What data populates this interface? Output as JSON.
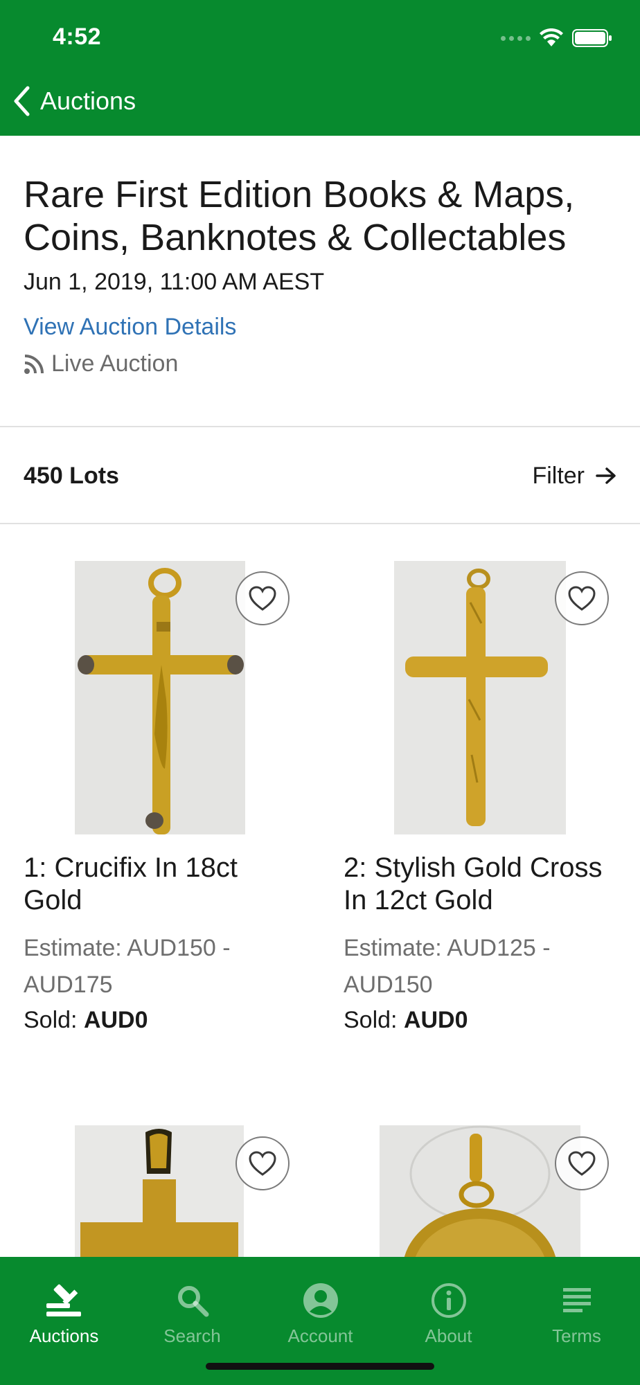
{
  "status_bar": {
    "time": "4:52"
  },
  "nav": {
    "back_label": "Auctions"
  },
  "auction": {
    "title": "Rare First Edition Books & Maps, Coins, Banknotes & Collectables",
    "date": "Jun 1, 2019, 11:00 AM AEST",
    "details_link": "View Auction Details",
    "type_label": "Live Auction"
  },
  "lots_header": {
    "count_label": "450 Lots",
    "filter_label": "Filter"
  },
  "lots": [
    {
      "title": "1: Crucifix In 18ct Gold",
      "estimate": "Estimate: AUD150 - AUD175",
      "sold_label": "Sold:",
      "sold_value": "AUD0"
    },
    {
      "title": "2: Stylish Gold Cross In 12ct Gold",
      "estimate": "Estimate: AUD125 - AUD150",
      "sold_label": "Sold:",
      "sold_value": "AUD0"
    }
  ],
  "tabs": [
    {
      "label": "Auctions",
      "icon": "gavel-icon",
      "active": true
    },
    {
      "label": "Search",
      "icon": "search-icon",
      "active": false
    },
    {
      "label": "Account",
      "icon": "account-icon",
      "active": false
    },
    {
      "label": "About",
      "icon": "info-icon",
      "active": false
    },
    {
      "label": "Terms",
      "icon": "list-icon",
      "active": false
    }
  ],
  "colors": {
    "brand_green": "#078a2e",
    "link_blue": "#2f72b5",
    "muted_text": "#6e6e6e"
  }
}
